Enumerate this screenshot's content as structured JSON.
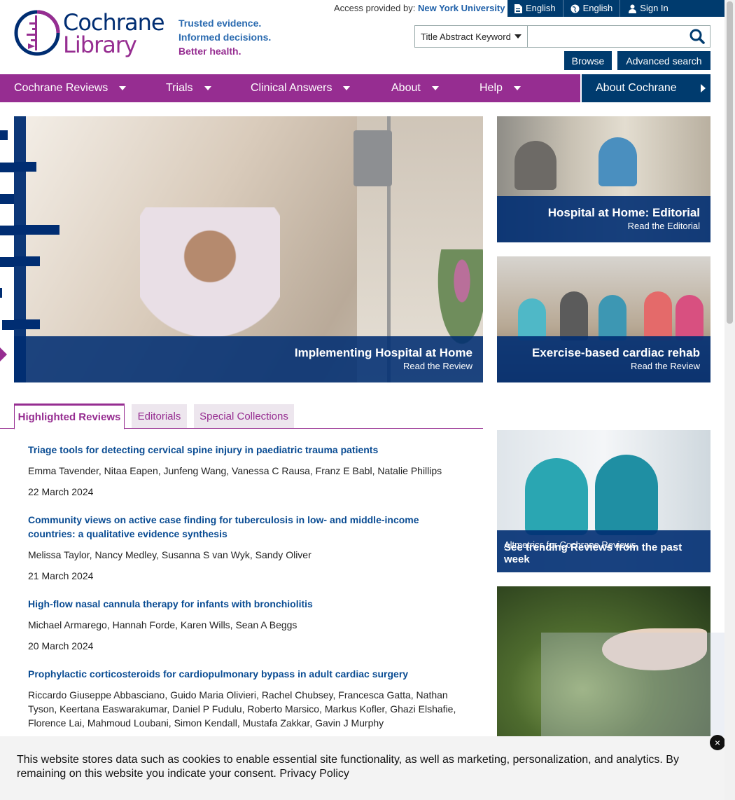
{
  "header": {
    "logo_line1": "Cochrane",
    "logo_line2": "Library",
    "tagline": [
      "Trusted evidence.",
      "Informed decisions.",
      "Better health."
    ],
    "access_label": "Access provided by:",
    "access_org": "New York University",
    "topbar": {
      "lang1": "English",
      "lang2": "English",
      "signin": "Sign In"
    },
    "search": {
      "field_select": "Title Abstract Keyword",
      "placeholder": ""
    },
    "browse_label": "Browse",
    "advanced_label": "Advanced search"
  },
  "nav": {
    "items": [
      {
        "label": "Cochrane Reviews"
      },
      {
        "label": "Trials"
      },
      {
        "label": "Clinical Answers"
      },
      {
        "label": "About"
      },
      {
        "label": "Help"
      }
    ],
    "about_cochrane": "About Cochrane"
  },
  "hero": {
    "title": "Implementing Hospital at Home",
    "subtitle": "Read the Review"
  },
  "cards": {
    "card1": {
      "title": "Hospital at Home: Editorial",
      "subtitle": "Read the Editorial"
    },
    "card2": {
      "title": "Exercise-based cardiac rehab",
      "subtitle": "Read the Review"
    },
    "card3": {
      "small": "Altmetrics for Cochrane Reviews",
      "title": "See trending Reviews from the past week"
    }
  },
  "tabs": [
    {
      "label": "Highlighted Reviews"
    },
    {
      "label": "Editorials"
    },
    {
      "label": "Special Collections"
    }
  ],
  "reviews": [
    {
      "title": "Triage tools for detecting cervical spine injury in paediatric trauma patients",
      "authors": "Emma Tavender, Nitaa Eapen, Junfeng Wang, Vanessa C Rausa, Franz E Babl, Natalie Phillips",
      "date": "22 March 2024"
    },
    {
      "title": "Community views on active case finding for tuberculosis in low- and middle-income countries: a qualitative evidence synthesis",
      "authors": "Melissa Taylor, Nancy Medley, Susanna S van Wyk, Sandy Oliver",
      "date": "21 March 2024"
    },
    {
      "title": "High-flow nasal cannula therapy for infants with bronchiolitis",
      "authors": "Michael Armarego, Hannah Forde, Karen Wills, Sean A Beggs",
      "date": "20 March 2024"
    },
    {
      "title": "Prophylactic corticosteroids for cardiopulmonary bypass in adult cardiac surgery",
      "authors": "Riccardo Giuseppe Abbasciano, Guido Maria Olivieri, Rachel Chubsey, Francesca Gatta, Nathan Tyson, Keertana Easwarakumar, Daniel P Fudulu, Roberto Marsico, Markus Kofler, Ghazi Elshafie, Florence Lai, Mahmoud Loubani, Simon Kendall, Mustafa Zakkar, Gavin J Murphy",
      "date": ""
    }
  ],
  "cookie": {
    "text": "This website stores data such as cookies to enable essential site functionality, as well as marketing, personalization, and analytics. By remaining on this website you indicate your consent. Privacy Policy",
    "close": "×"
  },
  "colors": {
    "brand_purple": "#962d91",
    "brand_navy": "#003b6e",
    "link_blue": "#0a4c93"
  }
}
